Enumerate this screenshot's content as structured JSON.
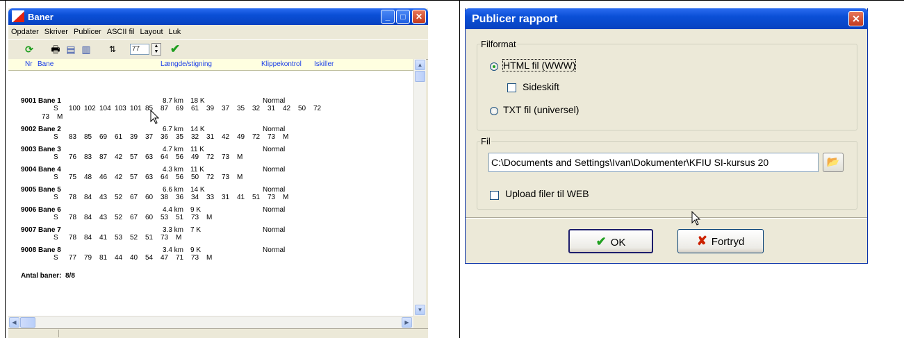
{
  "baner": {
    "title": "Baner",
    "menu": [
      "Opdater",
      "Skriver",
      "Publicer",
      "ASCII fil",
      "Layout",
      "Luk"
    ],
    "toolbar": {
      "spin_value": "77"
    },
    "header": {
      "nr": "Nr",
      "bane": "Bane",
      "laengde": "Længde/stigning",
      "klippe": "Klippekontrol",
      "iskiller": "Iskiller"
    },
    "courses": [
      {
        "name": "9001 Bane 1",
        "length": "8.7 km",
        "climb": "18 K",
        "status": "Normal",
        "lines": [
          [
            "S",
            "100",
            "102",
            "104",
            "103",
            "101",
            "85",
            "87",
            "69",
            "61",
            "39",
            "37",
            "35",
            "32",
            "31",
            "42",
            "50",
            "72"
          ],
          [
            "73",
            "M"
          ]
        ]
      },
      {
        "name": "9002 Bane 2",
        "length": "6.7 km",
        "climb": "14 K",
        "status": "Normal",
        "lines": [
          [
            "S",
            "83",
            "85",
            "69",
            "61",
            "39",
            "37",
            "36",
            "35",
            "32",
            "31",
            "42",
            "49",
            "72",
            "73",
            "M"
          ]
        ]
      },
      {
        "name": "9003 Bane 3",
        "length": "4.7 km",
        "climb": "11 K",
        "status": "Normal",
        "lines": [
          [
            "S",
            "76",
            "83",
            "87",
            "42",
            "57",
            "63",
            "64",
            "56",
            "49",
            "72",
            "73",
            "M"
          ]
        ]
      },
      {
        "name": "9004 Bane 4",
        "length": "4.3 km",
        "climb": "11 K",
        "status": "Normal",
        "lines": [
          [
            "S",
            "75",
            "48",
            "46",
            "42",
            "57",
            "63",
            "64",
            "56",
            "50",
            "72",
            "73",
            "M"
          ]
        ]
      },
      {
        "name": "9005 Bane 5",
        "length": "6.6 km",
        "climb": "14 K",
        "status": "Normal",
        "lines": [
          [
            "S",
            "78",
            "84",
            "43",
            "52",
            "67",
            "60",
            "38",
            "36",
            "34",
            "33",
            "31",
            "41",
            "51",
            "73",
            "M"
          ]
        ]
      },
      {
        "name": "9006 Bane 6",
        "length": "4.4 km",
        "climb": "9 K",
        "status": "Normal",
        "lines": [
          [
            "S",
            "78",
            "84",
            "43",
            "52",
            "67",
            "60",
            "53",
            "51",
            "73",
            "M"
          ]
        ]
      },
      {
        "name": "9007 Bane 7",
        "length": "3.3 km",
        "climb": "7 K",
        "status": "Normal",
        "lines": [
          [
            "S",
            "78",
            "84",
            "41",
            "53",
            "52",
            "51",
            "73",
            "M"
          ]
        ]
      },
      {
        "name": "9008 Bane 8",
        "length": "3.4 km",
        "climb": "9 K",
        "status": "Normal",
        "lines": [
          [
            "S",
            "77",
            "79",
            "81",
            "44",
            "40",
            "54",
            "47",
            "71",
            "73",
            "M"
          ]
        ]
      }
    ],
    "total_label": "Antal baner:",
    "total_value": "8/8"
  },
  "dialog": {
    "title": "Publicer rapport",
    "filformat_label": "Filformat",
    "html_option": "HTML fil (WWW)",
    "html_selected": true,
    "sideskift_label": "Sideskift",
    "sideskift_checked": false,
    "txt_option": "TXT fil (universel)",
    "fil_label": "Fil",
    "path_value": "C:\\Documents and Settings\\Ivan\\Dokumenter\\KFIU SI-kursus 20",
    "upload_label": "Upload filer til WEB",
    "upload_checked": false,
    "ok_label": "OK",
    "cancel_label": "Fortryd"
  },
  "colors": {
    "title_blue": "#0a4fd6",
    "header_text": "#1a3ee8",
    "header_bg": "#ffffe0",
    "ok_green": "#21a121",
    "cancel_red": "#cc2200"
  },
  "icons": [
    "refresh-icon",
    "print-icon",
    "print-preview-icon",
    "export-icon",
    "filter-icon",
    "check-icon",
    "folder-open-icon",
    "checkmark-icon",
    "x-icon"
  ]
}
